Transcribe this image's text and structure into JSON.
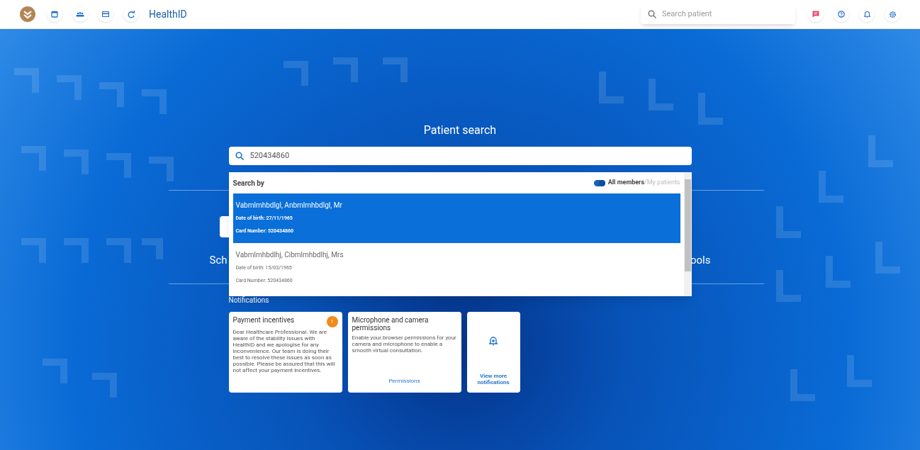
{
  "app": {
    "title": "HealthID"
  },
  "top_search": {
    "placeholder": "Search patient"
  },
  "page_title": "Patient search",
  "search": {
    "value": "520434860"
  },
  "dropdown": {
    "heading": "Search by",
    "toggle": {
      "on": true,
      "label_on": "All members",
      "separator": "/",
      "label_off": "My patients"
    },
    "results": [
      {
        "name": "Vabmlmhbdlgl, Anbmlmhbdlgl, Mr",
        "dob": "Date of birth: 27/11/1965",
        "card": "Card Number: 520434860",
        "selected": true
      },
      {
        "name": "Vabmlmhbdlhj, Cibmlmhbdlhj, Mrs",
        "dob": "Date of birth: 15/03/1965",
        "card": "Card Number: 520434860",
        "selected": false
      }
    ]
  },
  "tiles_behind": [
    "Sch",
    "ools"
  ],
  "notifications": {
    "label": "Notifications",
    "cards": [
      {
        "kind": "message",
        "title": "Payment incentives",
        "badge": "!",
        "body": "Dear Healthcare Professional. We are aware of the stability issues with HealthID and we apologise for any inconvenience. Our team is doing their best to resolve these issues as soon as possible. Please be assured that this will not affect your payment incentives."
      },
      {
        "kind": "action",
        "title": "Microphone and camera permissions",
        "body": "Enable your browser permissions for your camera and microphone to enable a smooth virtual consultation.",
        "link": "Permissions"
      },
      {
        "kind": "more",
        "link": "View more notifications"
      }
    ]
  }
}
